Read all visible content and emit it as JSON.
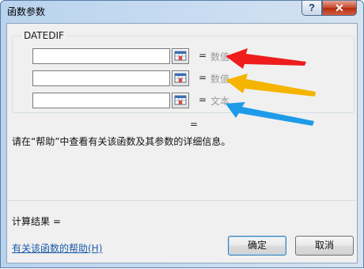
{
  "window": {
    "title": "函数参数",
    "help_button_label": "?",
    "close_button_label": "✕"
  },
  "function_group": {
    "name": "DATEDIF",
    "arguments": [
      {
        "value": "",
        "equals": "=",
        "hint": "数值"
      },
      {
        "value": "",
        "equals": "=",
        "hint": "数值"
      },
      {
        "value": "",
        "equals": "=",
        "hint": "文本"
      }
    ]
  },
  "function_result_equals": "=",
  "description": "请在“帮助”中查看有关该函数及其参数的详细信息。",
  "calc_result_label": "计算结果 =",
  "help_link": "有关该函数的帮助(H)",
  "buttons": {
    "ok": "确定",
    "cancel": "取消"
  },
  "annotation_colors": {
    "arrow_1": "#ee1c1c",
    "arrow_2": "#f5b400",
    "arrow_3": "#1e9be8"
  },
  "icons": {
    "ref_button": "range-select-icon"
  }
}
